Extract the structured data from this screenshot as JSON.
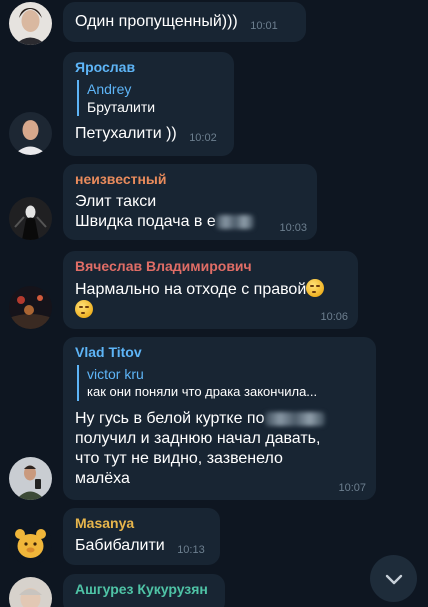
{
  "colors": {
    "background": "#0e1621",
    "bubble": "#182533",
    "time": "#6d7f8f",
    "reply_accent": "#5eb5f7"
  },
  "messages": [
    {
      "sender": "",
      "sender_color": "",
      "text": "Один пропущенный)))",
      "time": "10:01"
    },
    {
      "sender": "Ярослав",
      "sender_color": "#5eb5f7",
      "reply": {
        "name": "Andrey",
        "text": "Бруталити"
      },
      "text": "Петухалити ))",
      "time": "10:02"
    },
    {
      "sender": "неизвестный",
      "sender_color": "#e98b5c",
      "lines": [
        "Элит такси",
        "Швидка подача в е"
      ],
      "time": "10:03"
    },
    {
      "sender": "Вячеслав Владимирович",
      "sender_color": "#e06d66",
      "text": "Нармально на отходе с правой",
      "time": "10:06"
    },
    {
      "sender": "Vlad Titov",
      "sender_color": "#5eb5f7",
      "reply": {
        "name": "victor kru",
        "text": "как они поняли что драка закончила..."
      },
      "lines": [
        "Ну гусь в белой куртке по",
        "получил и заднюю начал давать,",
        "что тут не видно, зазвенело",
        "малёха"
      ],
      "time": "10:07"
    },
    {
      "sender": "Masanya",
      "sender_color": "#e8b64c",
      "text": "Бабибалити",
      "time": "10:13"
    },
    {
      "sender": "Ашгурез Кукурузян",
      "sender_color": "#4fc3a6"
    }
  ],
  "icons": {
    "scroll_down": "chevron-down-icon",
    "emoji": "smirk-emoji-icon"
  }
}
